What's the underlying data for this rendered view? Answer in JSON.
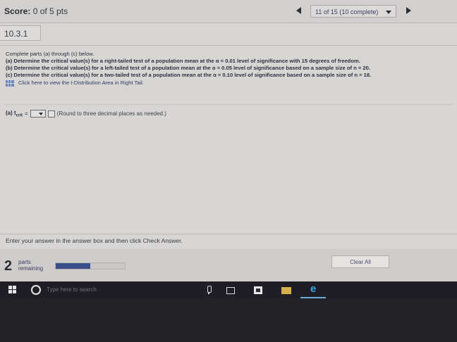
{
  "header": {
    "score_label": "Score:",
    "score_value": "0 of 5 pts",
    "progress_text": "11 of 15 (10 complete)"
  },
  "section": {
    "label": "10.3.1"
  },
  "question": {
    "intro": "Complete parts (a) through (c) below.",
    "part_a": "(a) Determine the critical value(s) for a right-tailed test of a population mean at the α = 0.01 level of significance with 15 degrees of freedom.",
    "part_b": "(b) Determine the critical value(s) for a left-tailed test of a population mean at the α = 0.05 level  of significance based on a sample size of n = 20.",
    "part_c": "(c) Determine the critical value(s) for a two-tailed test of a population mean at the α = 0.10 level of significance based on a sample size of n = 18.",
    "link_text": "Click here to view the t-Distribution Area in Right Tail."
  },
  "answer": {
    "part_label": "(a) t",
    "subscript": "crit",
    "equals": "=",
    "hint": "(Round to three decimal places as needed.)"
  },
  "footer": {
    "message": "Enter your answer in the answer box and then click Check Answer.",
    "parts_count": "2",
    "parts_line1": "parts",
    "parts_line2": "remaining",
    "progress_fraction": 0.5,
    "clear_button": "Clear All"
  },
  "taskbar": {
    "search_placeholder": "Type here to search",
    "icons": [
      "windows-start-icon",
      "search-icon",
      "microphone-icon",
      "task-view-icon",
      "store-icon",
      "file-explorer-icon",
      "edge-icon"
    ]
  },
  "colors": {
    "progress_fill": "#3b4e8c",
    "link": "#2f3a66",
    "taskbar": "#1e1e24"
  }
}
